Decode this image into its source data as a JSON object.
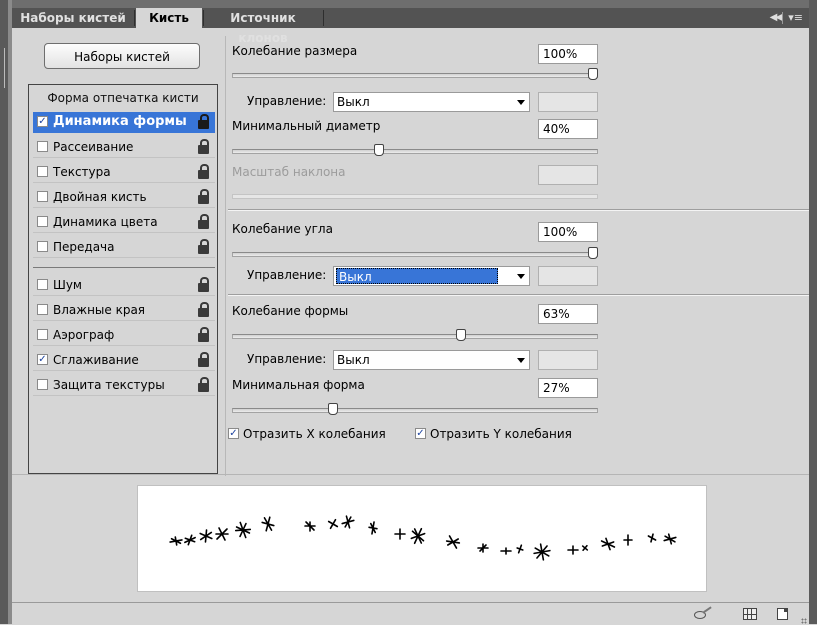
{
  "tabs": [
    "Наборы кистей",
    "Кисть",
    "Источник клонов"
  ],
  "active_tab": "Кисть",
  "tabbar_icons": [
    "collapse-icon",
    "panel-menu-icon"
  ],
  "presets_button": "Наборы кистей",
  "left": {
    "header": "Форма отпечатка кисти",
    "items": [
      {
        "label": "Динамика формы",
        "checked": true,
        "selected": true
      },
      {
        "label": "Рассеивание",
        "checked": false
      },
      {
        "label": "Текстура",
        "checked": false
      },
      {
        "label": "Двойная кисть",
        "checked": false
      },
      {
        "label": "Динамика цвета",
        "checked": false
      },
      {
        "label": "Передача",
        "checked": false
      },
      {
        "label": "Шум",
        "checked": false
      },
      {
        "label": "Влажные края",
        "checked": false
      },
      {
        "label": "Аэрограф",
        "checked": false
      },
      {
        "label": "Сглаживание",
        "checked": true
      },
      {
        "label": "Защита текстуры",
        "checked": false
      }
    ],
    "check_mark": "✓"
  },
  "right": {
    "size_jitter": {
      "label": "Колебание размера",
      "value": "100%",
      "level": 1.0
    },
    "size_control": {
      "label": "Управление:",
      "value": "Выкл"
    },
    "min_diameter": {
      "label": "Минимальный диаметр",
      "value": "40%",
      "level": 0.4
    },
    "tilt_scale": {
      "label": "Масштаб наклона",
      "value": ""
    },
    "angle_jitter": {
      "label": "Колебание угла",
      "value": "100%",
      "level": 1.0
    },
    "angle_control": {
      "label": "Управление:",
      "value": "Выкл"
    },
    "roundness_jitter": {
      "label": "Колебание формы",
      "value": "63%",
      "level": 0.63
    },
    "roundness_control": {
      "label": "Управление:",
      "value": "Выкл"
    },
    "min_roundness": {
      "label": "Минимальная форма",
      "value": "27%",
      "level": 0.27
    },
    "flip_x": {
      "label": "Отразить X колебания",
      "checked": true
    },
    "flip_y": {
      "label": "Отразить Y колебания",
      "checked": true
    }
  },
  "bottom_icons": [
    "toggle-brush-preview-icon",
    "brush-grid-icon",
    "new-brush-icon"
  ],
  "colors": {
    "selection": "#3875d7",
    "panel": "#d6d6d6",
    "tabbar": "#535353"
  }
}
